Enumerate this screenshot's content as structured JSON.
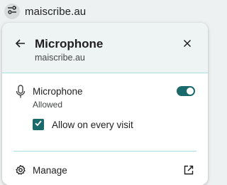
{
  "address_bar": {
    "url": "maiscribe.au",
    "site_info_icon": "tune-icon"
  },
  "popup": {
    "title": "Microphone",
    "subtitle": "maiscribe.au",
    "back_icon": "arrow-back-icon",
    "close_icon": "close-icon",
    "permission": {
      "icon": "microphone-icon",
      "label": "Microphone",
      "status": "Allowed",
      "toggle_on": true
    },
    "checkbox": {
      "label": "Allow on every visit",
      "checked": true
    },
    "manage": {
      "label": "Manage",
      "icon": "gear-icon",
      "external_icon": "open-in-new-icon"
    }
  },
  "colors": {
    "accent": "#1b6a6b",
    "divider": "#a8dfe2",
    "header_bg": "#eef4f4",
    "page_bg": "#eef1f1"
  }
}
